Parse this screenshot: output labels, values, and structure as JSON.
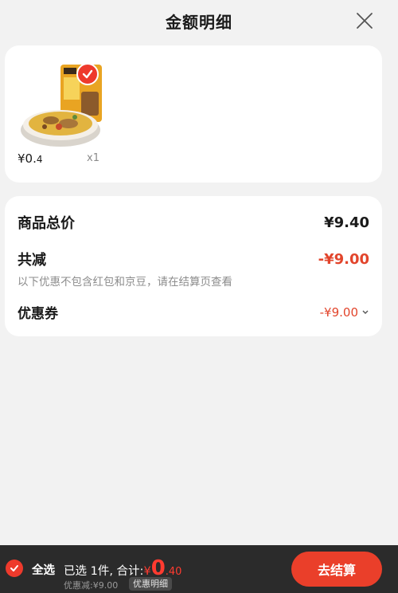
{
  "header": {
    "title": "金额明细"
  },
  "goods": {
    "price_symbol": "¥",
    "price_int": "0.",
    "price_dec": "4",
    "quantity": "x1",
    "selected": true
  },
  "price_detail": {
    "total_label": "商品总价",
    "total_value": "¥9.40",
    "reduce_label": "共减",
    "reduce_value": "-¥9.00",
    "note": "以下优惠不包含红包和京豆，请在结算页查看",
    "coupon_label": "优惠券",
    "coupon_value": "-¥9.00"
  },
  "bottom_bar": {
    "select_all": "全选",
    "selected_summary": "已选 1件, 合计:",
    "total_symbol": "¥",
    "total_int": "0",
    "total_dec": ".40",
    "discount_text": "优惠减:¥9.00",
    "detail_button": "优惠明细",
    "checkout_button": "去结算"
  },
  "colors": {
    "accent": "#ea3f2a",
    "price_red": "#e2452c",
    "bar_bg": "#2b2b2b"
  }
}
